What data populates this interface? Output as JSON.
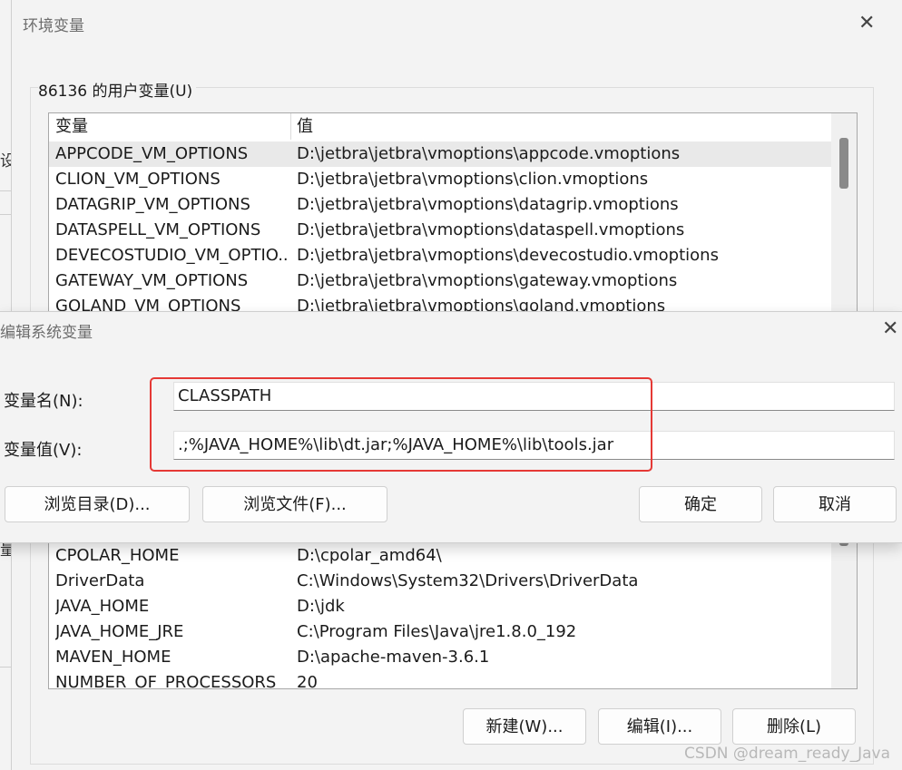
{
  "background": {
    "glyph_1": "设",
    "glyph_2": "量"
  },
  "env_window": {
    "title": "环境变量",
    "user_group_label": "86136 的用户变量(U)",
    "columns": [
      "变量",
      "值"
    ],
    "user_rows": [
      {
        "name": "APPCODE_VM_OPTIONS",
        "value": "D:\\jetbra\\jetbra\\vmoptions\\appcode.vmoptions"
      },
      {
        "name": "CLION_VM_OPTIONS",
        "value": "D:\\jetbra\\jetbra\\vmoptions\\clion.vmoptions"
      },
      {
        "name": "DATAGRIP_VM_OPTIONS",
        "value": "D:\\jetbra\\jetbra\\vmoptions\\datagrip.vmoptions"
      },
      {
        "name": "DATASPELL_VM_OPTIONS",
        "value": "D:\\jetbra\\jetbra\\vmoptions\\dataspell.vmoptions"
      },
      {
        "name": "DEVECOSTUDIO_VM_OPTIO...",
        "value": "D:\\jetbra\\jetbra\\vmoptions\\devecostudio.vmoptions"
      },
      {
        "name": "GATEWAY_VM_OPTIONS",
        "value": "D:\\jetbra\\jetbra\\vmoptions\\gateway.vmoptions"
      },
      {
        "name": "GOLAND_VM_OPTIONS",
        "value": "D:\\jetbra\\jetbra\\vmoptions\\goland.vmoptions"
      }
    ],
    "system_rows": [
      {
        "name": "CPOLAR_HOME",
        "value": "D:\\cpolar_amd64\\"
      },
      {
        "name": "DriverData",
        "value": "C:\\Windows\\System32\\Drivers\\DriverData"
      },
      {
        "name": "JAVA_HOME",
        "value": "D:\\jdk"
      },
      {
        "name": "JAVA_HOME_JRE",
        "value": "C:\\Program Files\\Java\\jre1.8.0_192"
      },
      {
        "name": "MAVEN_HOME",
        "value": "D:\\apache-maven-3.6.1"
      },
      {
        "name": "NUMBER_OF_PROCESSORS",
        "value": "20"
      }
    ],
    "buttons": {
      "new": "新建(W)...",
      "edit": "编辑(I)...",
      "delete": "删除(L)"
    }
  },
  "edit_dialog": {
    "title": "编辑系统变量",
    "name_label": "变量名(N):",
    "name_value": "CLASSPATH",
    "value_label": "变量值(V):",
    "value_value": ".;%JAVA_HOME%\\lib\\dt.jar;%JAVA_HOME%\\lib\\tools.jar",
    "buttons": {
      "browse_dir": "浏览目录(D)...",
      "browse_file": "浏览文件(F)...",
      "ok": "确定",
      "cancel": "取消"
    }
  },
  "close_glyph": "✕",
  "watermark": "CSDN @dream_ready_Java",
  "colors": {
    "highlight": "#e53935",
    "selected_row": "#e9e9e9"
  }
}
